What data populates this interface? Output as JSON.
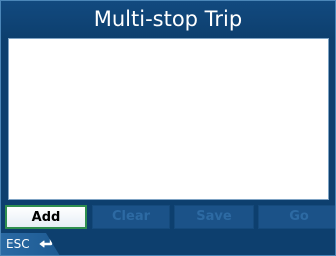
{
  "header": {
    "title": "Multi-stop Trip"
  },
  "list": {
    "items": []
  },
  "toolbar": {
    "add_label": "Add",
    "clear_label": "Clear",
    "save_label": "Save",
    "go_label": "Go"
  },
  "footer": {
    "esc_label": "ESC",
    "back_icon": "return-arrow-icon"
  },
  "colors": {
    "background": "#0d3f6e",
    "title_text": "#ffffff",
    "list_background": "#ffffff",
    "button_active_border": "#2f8f4f",
    "button_disabled": "#1b5288"
  }
}
